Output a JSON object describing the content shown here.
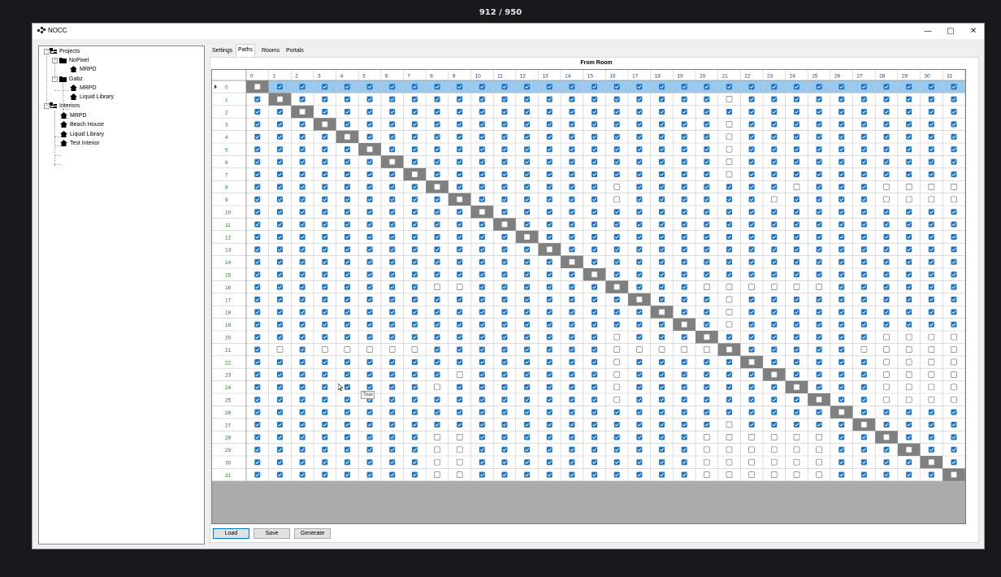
{
  "overlay": {
    "counter": "912 / 950"
  },
  "window": {
    "title": "NOCC",
    "controls": {
      "minimize": "—",
      "maximize": "▢",
      "close": "✕"
    }
  },
  "tree": {
    "projects_label": "Projects",
    "nopixel_label": "NoPixel",
    "nopixel_mrpd": "MRPD",
    "gabz_label": "Gabz",
    "gabz_mrpd": "MRPD",
    "gabz_liquid": "Liquid Library",
    "interiors_label": "Interiors",
    "int_mrpd": "MRPD",
    "int_beach": "Beach House",
    "int_liquid": "Liquid Library",
    "int_test": "Test Interior",
    "icons": {
      "root": "tree-root-icon",
      "folder": "folder-icon",
      "house": "house-icon"
    }
  },
  "tabs": {
    "settings": "Settings",
    "paths": "Paths",
    "rooms": "Rooms",
    "portals": "Portals"
  },
  "grid": {
    "header": "From Room",
    "size": 32,
    "selected_row": 0,
    "unchecked": [
      [
        1,
        21
      ],
      [
        3,
        21
      ],
      [
        4,
        21
      ],
      [
        5,
        21
      ],
      [
        6,
        21
      ],
      [
        7,
        21
      ],
      [
        8,
        16
      ],
      [
        8,
        24
      ],
      [
        8,
        28
      ],
      [
        8,
        29
      ],
      [
        8,
        30
      ],
      [
        8,
        31
      ],
      [
        9,
        16
      ],
      [
        9,
        23
      ],
      [
        9,
        28
      ],
      [
        9,
        29
      ],
      [
        9,
        30
      ],
      [
        9,
        31
      ],
      [
        16,
        8
      ],
      [
        16,
        9
      ],
      [
        16,
        20
      ],
      [
        16,
        21
      ],
      [
        16,
        22
      ],
      [
        16,
        23
      ],
      [
        16,
        24
      ],
      [
        16,
        25
      ],
      [
        17,
        21
      ],
      [
        18,
        21
      ],
      [
        19,
        21
      ],
      [
        20,
        16
      ],
      [
        20,
        28
      ],
      [
        20,
        29
      ],
      [
        20,
        30
      ],
      [
        20,
        31
      ],
      [
        21,
        1
      ],
      [
        21,
        3
      ],
      [
        21,
        4
      ],
      [
        21,
        5
      ],
      [
        21,
        6
      ],
      [
        21,
        7
      ],
      [
        21,
        16
      ],
      [
        21,
        17
      ],
      [
        21,
        18
      ],
      [
        21,
        19
      ],
      [
        21,
        20
      ],
      [
        21,
        27
      ],
      [
        21,
        28
      ],
      [
        21,
        29
      ],
      [
        21,
        30
      ],
      [
        21,
        31
      ],
      [
        22,
        16
      ],
      [
        22,
        28
      ],
      [
        22,
        29
      ],
      [
        22,
        30
      ],
      [
        22,
        31
      ],
      [
        23,
        9
      ],
      [
        23,
        16
      ],
      [
        23,
        28
      ],
      [
        23,
        29
      ],
      [
        23,
        30
      ],
      [
        23,
        31
      ],
      [
        24,
        8
      ],
      [
        24,
        16
      ],
      [
        24,
        28
      ],
      [
        24,
        29
      ],
      [
        24,
        30
      ],
      [
        24,
        31
      ],
      [
        25,
        16
      ],
      [
        25,
        28
      ],
      [
        25,
        29
      ],
      [
        25,
        30
      ],
      [
        25,
        31
      ],
      [
        27,
        21
      ],
      [
        28,
        8
      ],
      [
        28,
        9
      ],
      [
        28,
        20
      ],
      [
        28,
        21
      ],
      [
        28,
        22
      ],
      [
        28,
        23
      ],
      [
        28,
        24
      ],
      [
        28,
        25
      ],
      [
        29,
        8
      ],
      [
        29,
        9
      ],
      [
        29,
        20
      ],
      [
        29,
        21
      ],
      [
        29,
        22
      ],
      [
        29,
        23
      ],
      [
        29,
        24
      ],
      [
        29,
        25
      ],
      [
        30,
        8
      ],
      [
        30,
        9
      ],
      [
        30,
        20
      ],
      [
        30,
        21
      ],
      [
        30,
        22
      ],
      [
        30,
        23
      ],
      [
        30,
        24
      ],
      [
        30,
        25
      ],
      [
        31,
        8
      ],
      [
        31,
        9
      ],
      [
        31,
        20
      ],
      [
        31,
        21
      ],
      [
        31,
        22
      ],
      [
        31,
        23
      ],
      [
        31,
        24
      ],
      [
        31,
        25
      ]
    ],
    "colors": {
      "checked": "#1a73c8",
      "diagonal": "#808080",
      "selected_row": "#99c9ef",
      "row_header_text": "#207a20"
    }
  },
  "tooltip": "True",
  "buttons": {
    "load": "Load",
    "save": "Save",
    "generate": "Generate"
  }
}
